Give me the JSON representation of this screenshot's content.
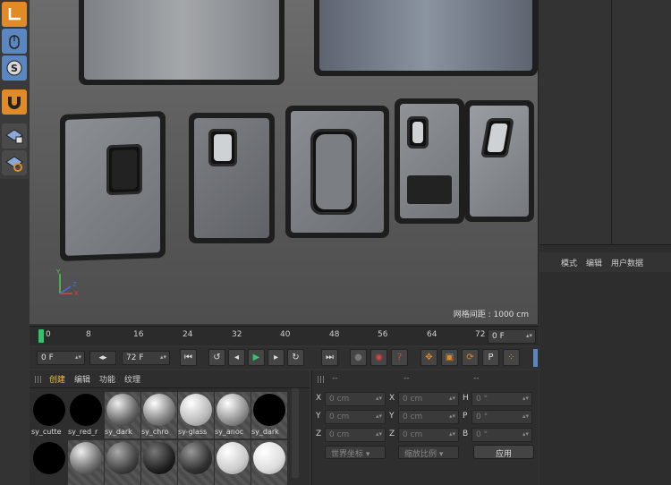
{
  "viewport": {
    "grid_spacing_label": "网格间距 : 1000 cm"
  },
  "right_panel": {
    "tabs": [
      "模式",
      "编辑",
      "用户数据"
    ]
  },
  "timeline": {
    "ticks": [
      "0",
      "8",
      "16",
      "24",
      "32",
      "40",
      "48",
      "56",
      "64",
      "72"
    ],
    "end_frame_field": "0 F"
  },
  "transport": {
    "current_frame": "0 F",
    "max_frame": "72 F"
  },
  "material_panel": {
    "tabs": [
      "创建",
      "编辑",
      "功能",
      "纹理"
    ],
    "materials_row1": [
      "sy_cutte",
      "sy_red_r",
      "sy_dark",
      "sy_chro",
      "sy-glass",
      "sy_anoc",
      "sy_dark"
    ],
    "materials_row2": [
      "",
      "",
      "",
      "",
      "",
      "",
      ""
    ]
  },
  "coord_panel": {
    "headers": [
      "--",
      "--",
      "--"
    ],
    "rows": [
      {
        "l1": "X",
        "v1": "0 cm",
        "l2": "X",
        "v2": "0 cm",
        "l3": "H",
        "v3": "0 °"
      },
      {
        "l1": "Y",
        "v1": "0 cm",
        "l2": "Y",
        "v2": "0 cm",
        "l3": "P",
        "v3": "0 °"
      },
      {
        "l1": "Z",
        "v1": "0 cm",
        "l2": "Z",
        "v2": "0 cm",
        "l3": "B",
        "v3": "0 °"
      }
    ],
    "coord_system": "世界坐标",
    "scale_mode": "缩放比例",
    "apply_label": "应用"
  },
  "colors": {
    "accent_orange": "#e08a28",
    "accent_blue": "#5b86c0",
    "playhead_green": "#2fc46a",
    "active_tab": "#f0c040"
  }
}
